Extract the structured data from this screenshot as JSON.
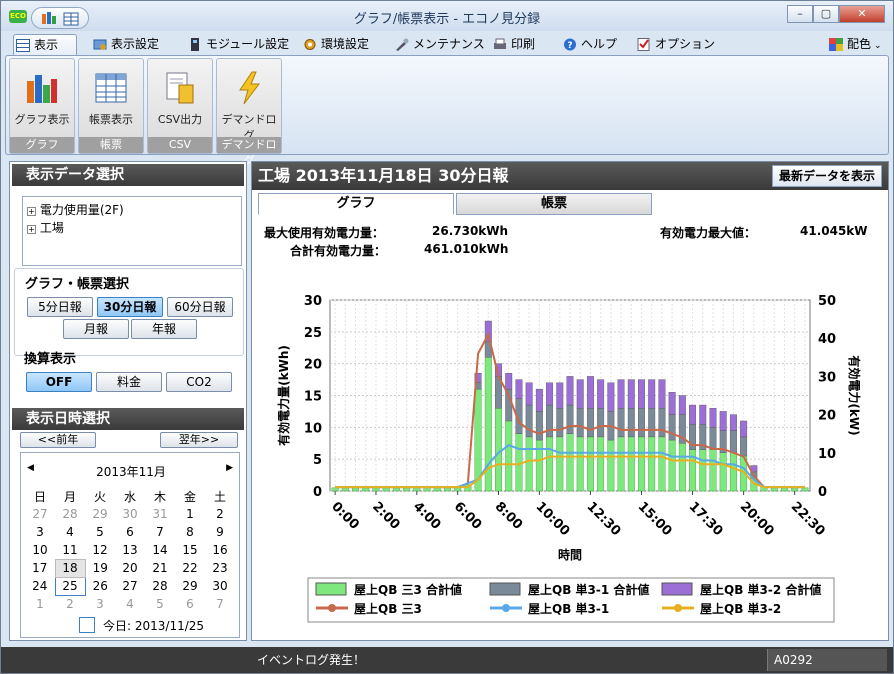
{
  "window": {
    "title": "グラフ/帳票表示 - エコノ見分録",
    "app_badge": "ECO"
  },
  "menu_tabs": [
    {
      "label": "表示"
    },
    {
      "label": "表示設定"
    },
    {
      "label": "モジュール設定"
    },
    {
      "label": "環境設定"
    },
    {
      "label": "メンテナンス"
    },
    {
      "label": "印刷"
    },
    {
      "label": "ヘルプ"
    },
    {
      "label": "オプション"
    }
  ],
  "color_menu": {
    "label": "配色"
  },
  "ribbon": {
    "groups": [
      {
        "button": "グラフ表示",
        "group": "グラフ",
        "icon": "bar-chart-icon"
      },
      {
        "button": "帳票表示",
        "group": "帳票",
        "icon": "table-icon"
      },
      {
        "button": "CSV出力",
        "group": "CSV",
        "icon": "csv-export-icon"
      },
      {
        "button": "デマンドログ",
        "group": "デマンドログ",
        "icon": "lightning-icon"
      }
    ]
  },
  "left": {
    "data_select_title": "表示データ選択",
    "tree": [
      {
        "label": "電力使用量(2F)"
      },
      {
        "label": "工場"
      }
    ],
    "graph_report_title": "グラフ・帳票選択",
    "report_buttons": [
      "5分日報",
      "30分日報",
      "60分日報",
      "月報",
      "年報"
    ],
    "selected_report": "30分日報",
    "conversion_title": "換算表示",
    "conversion_buttons": [
      "OFF",
      "料金",
      "CO2"
    ],
    "datetime_title": "表示日時選択",
    "prev_label": "<<前年",
    "next_label": "翌年>>",
    "calendar": {
      "month_label": "2013年11月",
      "weekdays": [
        "日",
        "月",
        "火",
        "水",
        "木",
        "金",
        "土"
      ],
      "weeks": [
        [
          "27",
          "28",
          "29",
          "30",
          "31",
          "1",
          "2"
        ],
        [
          "3",
          "4",
          "5",
          "6",
          "7",
          "8",
          "9"
        ],
        [
          "10",
          "11",
          "12",
          "13",
          "14",
          "15",
          "16"
        ],
        [
          "17",
          "18",
          "19",
          "20",
          "21",
          "22",
          "23"
        ],
        [
          "24",
          "25",
          "26",
          "27",
          "28",
          "29",
          "30"
        ],
        [
          "1",
          "2",
          "3",
          "4",
          "5",
          "6",
          "7"
        ]
      ],
      "today_label": "今日: 2013/11/25"
    }
  },
  "main": {
    "header": "工場 2013年11月18日 30分日報",
    "refresh_label": "最新データを表示",
    "tab_graph": "グラフ",
    "tab_report": "帳票",
    "stats": {
      "max_label": "最大使用有効電力量：",
      "max_value": "26.730kWh",
      "total_label": "合計有効電力量：",
      "total_value": "461.010kWh",
      "peak_label": "有効電力最大値：",
      "peak_value": "41.045kW"
    }
  },
  "chart_data": {
    "type": "bar",
    "xlabel": "時間",
    "ylabel_left": "有効電力量(kWh)",
    "ylabel_right": "有効電力(kW)",
    "ylim_left": [
      0,
      30
    ],
    "ylim_right": [
      0,
      50
    ],
    "x_tick_labels": [
      "0:00",
      "2:00",
      "4:00",
      "6:00",
      "8:00",
      "10:00",
      "12:30",
      "15:00",
      "17:30",
      "20:00",
      "22:30"
    ],
    "categories": [
      "0:00",
      "0:30",
      "1:00",
      "1:30",
      "2:00",
      "2:30",
      "3:00",
      "3:30",
      "4:00",
      "4:30",
      "5:00",
      "5:30",
      "6:00",
      "6:30",
      "7:00",
      "7:30",
      "8:00",
      "8:30",
      "9:00",
      "9:30",
      "10:00",
      "10:30",
      "11:00",
      "11:30",
      "12:00",
      "12:30",
      "13:00",
      "13:30",
      "14:00",
      "14:30",
      "15:00",
      "15:30",
      "16:00",
      "16:30",
      "17:00",
      "17:30",
      "18:00",
      "18:30",
      "19:00",
      "19:30",
      "20:00",
      "20:30",
      "21:00",
      "21:30",
      "22:00",
      "22:30",
      "23:00"
    ],
    "series": [
      {
        "name": "屋上QB 三3 合計値",
        "color": "#7ee87e",
        "values": [
          0.5,
          0.5,
          0.5,
          0.5,
          0.5,
          0.5,
          0.5,
          0.5,
          0.5,
          0.5,
          0.5,
          0.5,
          0.5,
          1.0,
          16.0,
          21.0,
          13.0,
          11.0,
          9.0,
          8.5,
          8.0,
          8.5,
          8.5,
          9.0,
          8.5,
          8.5,
          8.5,
          8.0,
          8.5,
          8.5,
          8.5,
          8.5,
          8.5,
          8.0,
          7.5,
          6.5,
          6.5,
          6.5,
          6.0,
          6.0,
          5.5,
          2.0,
          0.6,
          0.5,
          0.5,
          0.5,
          0.5
        ]
      },
      {
        "name": "屋上QB 単3-1 合計値",
        "color": "#7a8a99",
        "values": [
          0,
          0,
          0,
          0,
          0,
          0,
          0,
          0,
          0,
          0,
          0,
          0,
          0,
          0,
          1.0,
          2.5,
          5.0,
          5.0,
          5.5,
          5.0,
          4.5,
          5.0,
          4.5,
          4.5,
          4.5,
          4.5,
          4.5,
          4.5,
          4.5,
          4.5,
          4.5,
          4.5,
          4.5,
          4.0,
          4.5,
          4.0,
          4.0,
          3.5,
          3.5,
          3.5,
          3.0,
          1.0,
          0,
          0,
          0,
          0,
          0
        ]
      },
      {
        "name": "屋上QB 単3-2 合計値",
        "color": "#9b6fd6",
        "values": [
          0,
          0,
          0,
          0,
          0,
          0,
          0,
          0,
          0,
          0,
          0,
          0,
          0,
          0,
          1.5,
          3.2,
          2.0,
          2.5,
          3.0,
          3.5,
          3.5,
          3.5,
          4.0,
          4.5,
          4.5,
          5.0,
          4.5,
          4.5,
          4.5,
          4.5,
          4.5,
          4.5,
          4.5,
          3.5,
          3.0,
          3.0,
          3.0,
          3.0,
          3.0,
          2.5,
          2.5,
          1.0,
          0,
          0,
          0,
          0,
          0
        ]
      },
      {
        "name": "屋上QB 三3",
        "color": "#c86a4a",
        "values": [
          1,
          1,
          1,
          1,
          1,
          1,
          1,
          1,
          1,
          1,
          1,
          1,
          1,
          2,
          36,
          41,
          30,
          25,
          18,
          16,
          15,
          16,
          16,
          17,
          17,
          16,
          17,
          17,
          16,
          16,
          16,
          16,
          16,
          15,
          14,
          12,
          12,
          11,
          11,
          10,
          9,
          4,
          1,
          1,
          1,
          1,
          1
        ]
      },
      {
        "name": "屋上QB 単3-1",
        "color": "#5aa8e6",
        "values": [
          1,
          1,
          1,
          1,
          1,
          1,
          1,
          1,
          1,
          1,
          1,
          1,
          1,
          2,
          3,
          7,
          10,
          12,
          11,
          11,
          11,
          11,
          10,
          10,
          10,
          10,
          10,
          10,
          10,
          10,
          10,
          10,
          10,
          9,
          9,
          9,
          8,
          8,
          7,
          7,
          6,
          3,
          1,
          1,
          1,
          1,
          1
        ]
      },
      {
        "name": "屋上QB 単3-2",
        "color": "#e8b020",
        "values": [
          1,
          1,
          1,
          1,
          1,
          1,
          1,
          1,
          1,
          1,
          1,
          1,
          1,
          1,
          3,
          6,
          7,
          7,
          7,
          8,
          8,
          9,
          9,
          9,
          9,
          9,
          9,
          9,
          9,
          9,
          9,
          9,
          9,
          8,
          8,
          8,
          7,
          7,
          7,
          6,
          5,
          2,
          1,
          1,
          1,
          1,
          1
        ]
      }
    ]
  },
  "status": {
    "event": "イベントログ発生！",
    "code": "A0292"
  }
}
